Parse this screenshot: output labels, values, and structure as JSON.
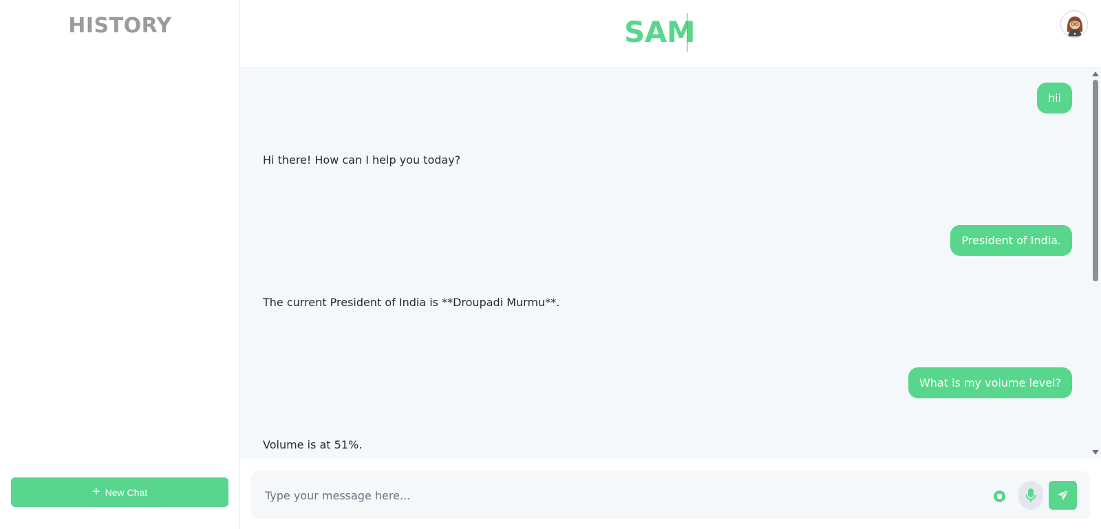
{
  "sidebar": {
    "title": "HISTORY",
    "new_chat_label": "New Chat"
  },
  "header": {
    "brand": "SAM",
    "avatar_icon": "user-avatar-icon"
  },
  "chat": {
    "messages": [
      {
        "role": "user",
        "text": "hii"
      },
      {
        "role": "assistant",
        "text": "Hi there! How can I help you today?"
      },
      {
        "role": "user",
        "text": "President of India."
      },
      {
        "role": "assistant",
        "text": "The current President of India is **Droupadi Murmu**."
      },
      {
        "role": "user",
        "text": "What is my volume level?"
      },
      {
        "role": "assistant",
        "text": "Volume is at 51%."
      }
    ]
  },
  "composer": {
    "placeholder": "Type your message here...",
    "value": "",
    "mic_icon": "microphone-icon",
    "send_icon": "send-icon"
  },
  "colors": {
    "accent": "#58d68d",
    "chat_bg": "#f5f8fb",
    "sidebar_title": "#9b9b9b"
  }
}
